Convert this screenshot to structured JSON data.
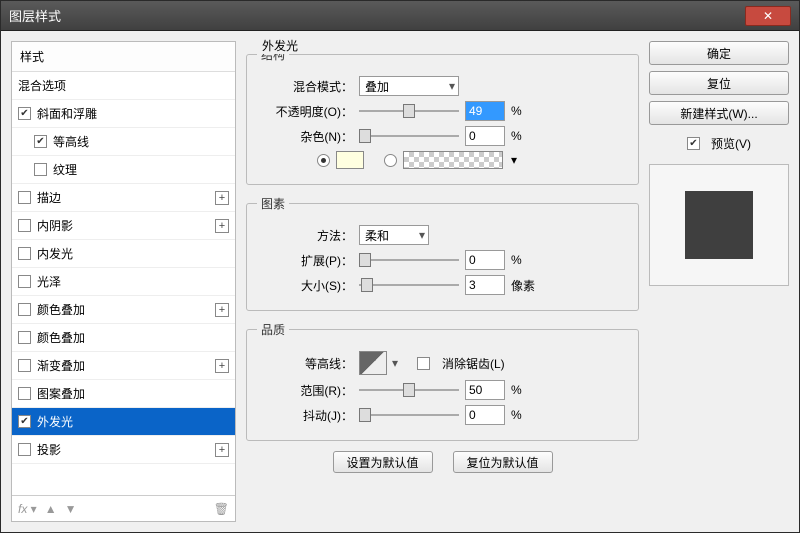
{
  "window": {
    "title": "图层样式"
  },
  "left": {
    "header": "样式",
    "items": [
      {
        "label": "混合选项",
        "checked": null,
        "sub": false,
        "plus": false
      },
      {
        "label": "斜面和浮雕",
        "checked": true,
        "sub": false,
        "plus": false
      },
      {
        "label": "等高线",
        "checked": true,
        "sub": true,
        "plus": false
      },
      {
        "label": "纹理",
        "checked": false,
        "sub": true,
        "plus": false
      },
      {
        "label": "描边",
        "checked": false,
        "sub": false,
        "plus": true
      },
      {
        "label": "内阴影",
        "checked": false,
        "sub": false,
        "plus": true
      },
      {
        "label": "内发光",
        "checked": false,
        "sub": false,
        "plus": false
      },
      {
        "label": "光泽",
        "checked": false,
        "sub": false,
        "plus": false
      },
      {
        "label": "颜色叠加",
        "checked": false,
        "sub": false,
        "plus": true
      },
      {
        "label": "颜色叠加",
        "checked": false,
        "sub": false,
        "plus": false
      },
      {
        "label": "渐变叠加",
        "checked": false,
        "sub": false,
        "plus": true
      },
      {
        "label": "图案叠加",
        "checked": false,
        "sub": false,
        "plus": false
      },
      {
        "label": "外发光",
        "checked": true,
        "sub": false,
        "plus": false,
        "selected": true
      },
      {
        "label": "投影",
        "checked": false,
        "sub": false,
        "plus": true
      }
    ],
    "footer_fx": "fx"
  },
  "panel": {
    "title": "外发光",
    "structure": {
      "legend": "结构",
      "blend_label": "混合模式：",
      "blend_value": "叠加",
      "opacity_label": "不透明度(O)：",
      "opacity_value": "49",
      "opacity_unit": "%",
      "noise_label": "杂色(N)：",
      "noise_value": "0",
      "noise_unit": "%"
    },
    "elements": {
      "legend": "图素",
      "method_label": "方法：",
      "method_value": "柔和",
      "spread_label": "扩展(P)：",
      "spread_value": "0",
      "spread_unit": "%",
      "size_label": "大小(S)：",
      "size_value": "3",
      "size_unit": "像素"
    },
    "quality": {
      "legend": "品质",
      "contour_label": "等高线：",
      "antialias_label": "消除锯齿(L)",
      "range_label": "范围(R)：",
      "range_value": "50",
      "range_unit": "%",
      "jitter_label": "抖动(J)：",
      "jitter_value": "0",
      "jitter_unit": "%"
    },
    "defaults": {
      "set": "设置为默认值",
      "reset": "复位为默认值"
    }
  },
  "right": {
    "ok": "确定",
    "cancel": "复位",
    "new_style": "新建样式(W)...",
    "preview": "预览(V)"
  }
}
